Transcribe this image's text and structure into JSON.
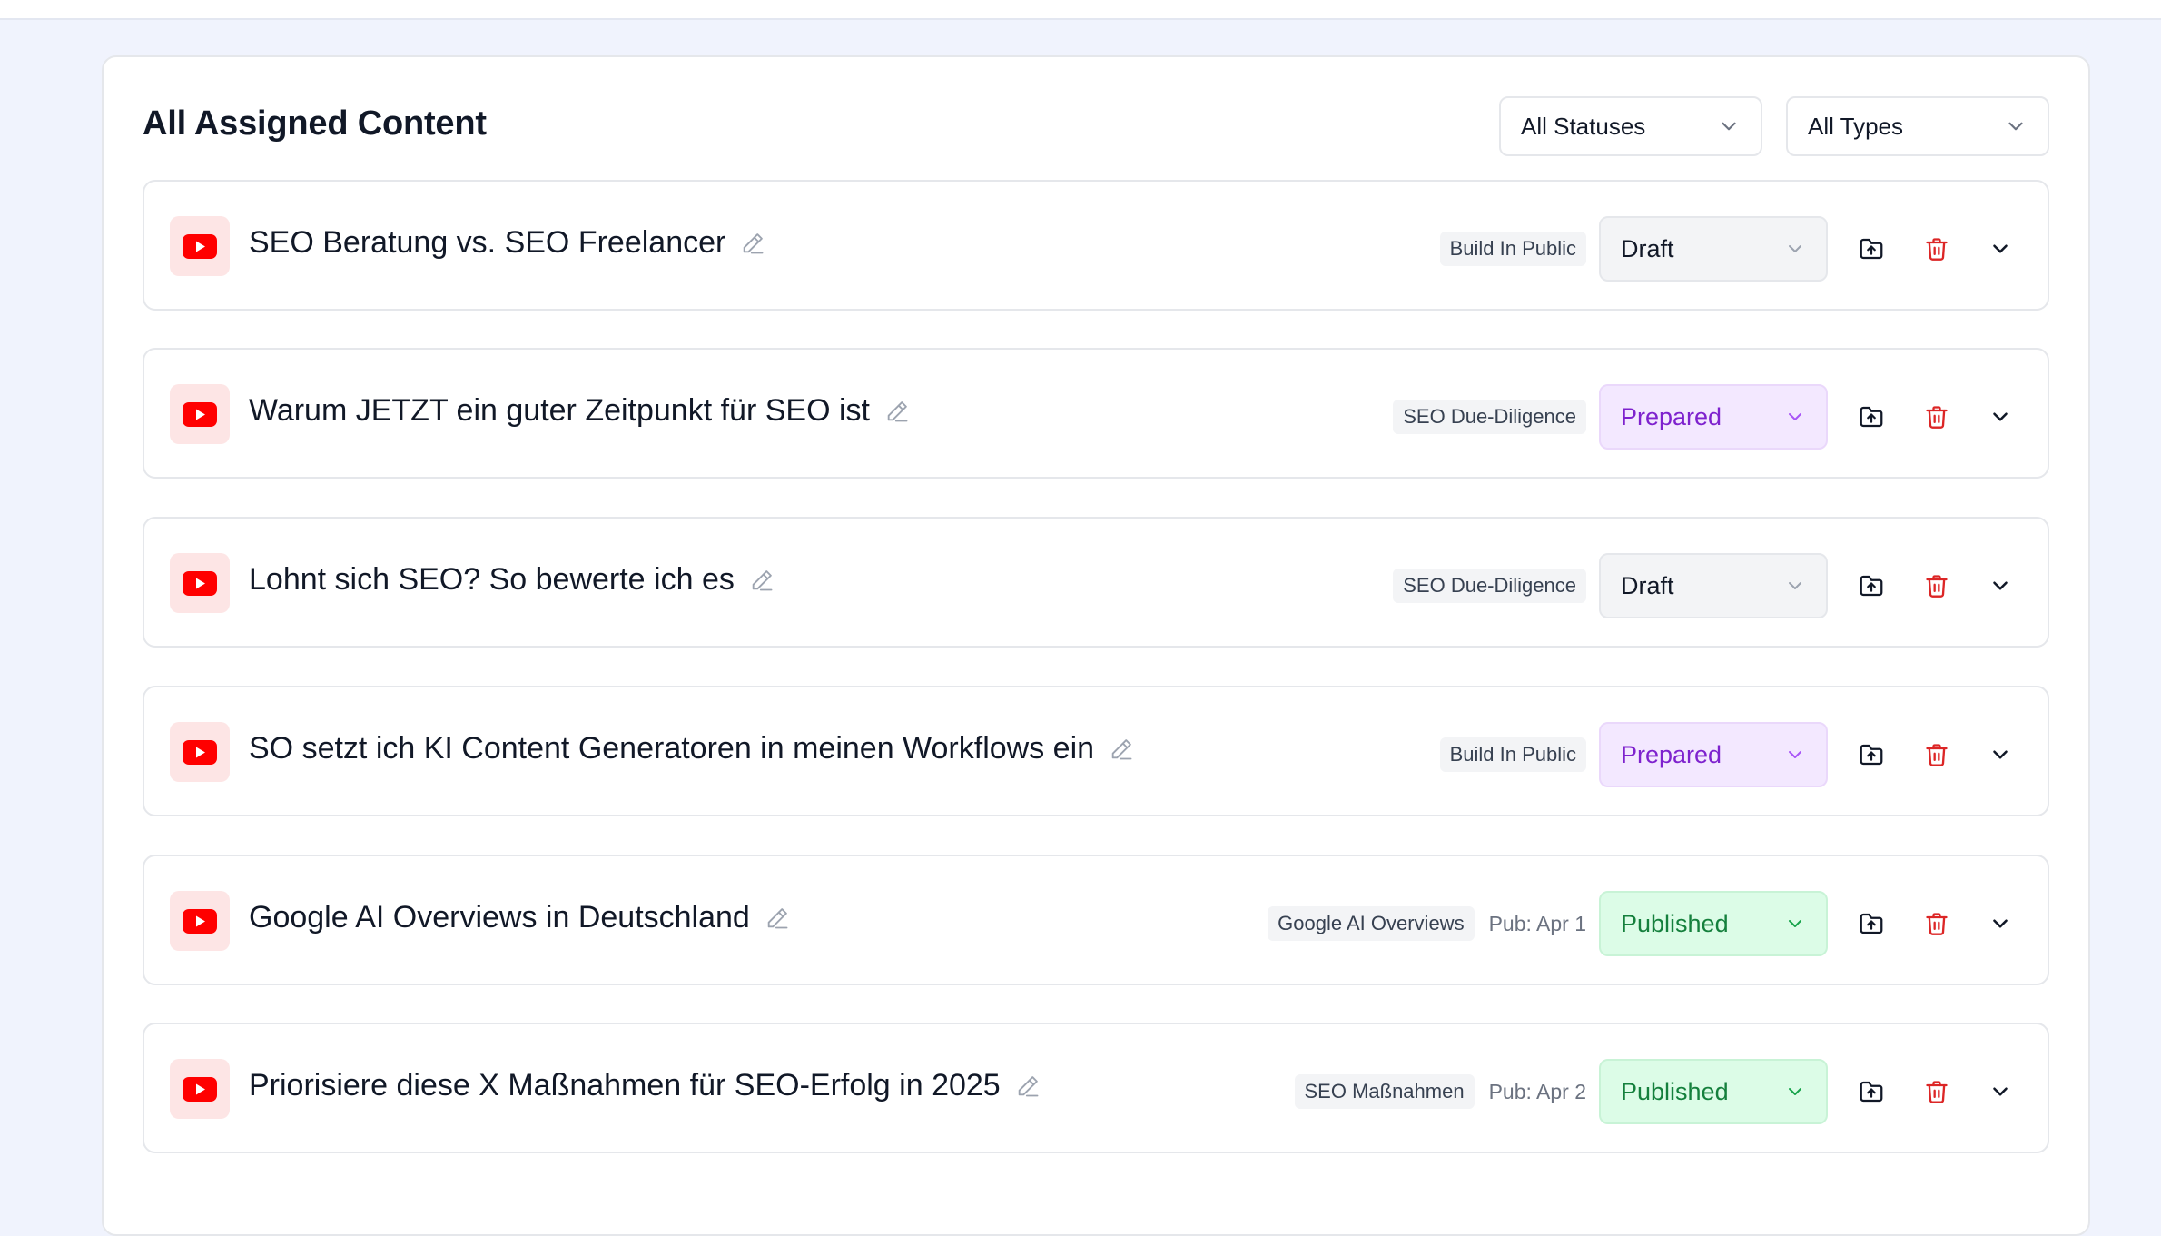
{
  "header": {
    "title": "All Assigned Content"
  },
  "filters": {
    "status": "All Statuses",
    "type": "All Types"
  },
  "colors": {
    "youtube_red": "#ff0000",
    "trash_red": "#dc2626",
    "prepared_bg": "#f3e8ff",
    "published_bg": "#dcfce7",
    "draft_bg": "#f3f4f6"
  },
  "items": [
    {
      "title": "SEO Beratung vs. SEO Freelancer",
      "tag": "Build In Public",
      "pub": "",
      "status": "Draft",
      "status_kind": "draft",
      "icon": "youtube-icon"
    },
    {
      "title": "Warum JETZT ein guter Zeitpunkt für SEO ist",
      "tag": "SEO Due-Diligence",
      "pub": "",
      "status": "Prepared",
      "status_kind": "prepared",
      "icon": "youtube-icon"
    },
    {
      "title": "Lohnt sich SEO? So bewerte ich es",
      "tag": "SEO Due-Diligence",
      "pub": "",
      "status": "Draft",
      "status_kind": "draft",
      "icon": "youtube-icon"
    },
    {
      "title": "SO setzt ich KI Content Generatoren in meinen Workflows ein",
      "tag": "Build In Public",
      "pub": "",
      "status": "Prepared",
      "status_kind": "prepared",
      "icon": "youtube-icon"
    },
    {
      "title": "Google AI Overviews in Deutschland",
      "tag": "Google AI Overviews",
      "pub": "Pub: Apr 1",
      "status": "Published",
      "status_kind": "published",
      "icon": "youtube-icon"
    },
    {
      "title": "Priorisiere diese X Maßnahmen für SEO-Erfolg in 2025",
      "tag": "SEO Maßnahmen",
      "pub": "Pub: Apr 2",
      "status": "Published",
      "status_kind": "published",
      "icon": "youtube-icon"
    }
  ]
}
